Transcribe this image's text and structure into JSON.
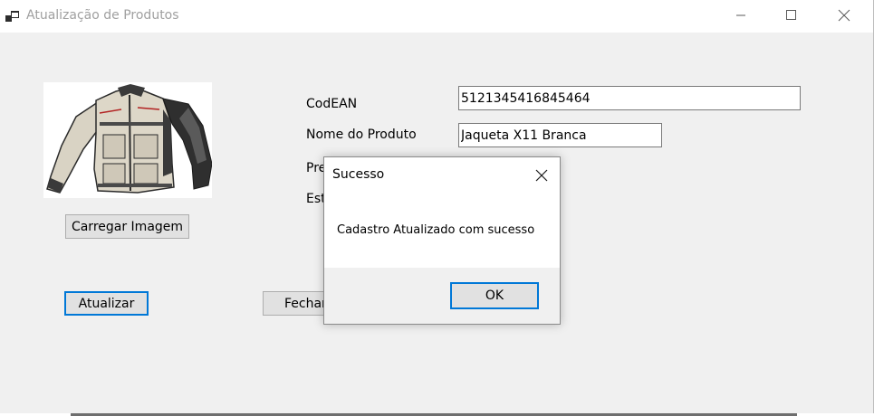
{
  "window": {
    "title": "Atualização de Produtos",
    "app_icon": "app-window-icon",
    "controls": [
      "minimize-icon",
      "maximize-icon",
      "close-icon"
    ]
  },
  "form": {
    "product_image_icon": "jacket-product-image",
    "load_image_button": "Carregar Imagem",
    "update_button": "Atualizar",
    "close_button": "Fechar",
    "labels": {
      "codean": "CodEAN",
      "nome": "Nome do Produto",
      "preco": "Pre",
      "estoque": "Est"
    },
    "fields": {
      "codean_value": "5121345416845464",
      "nome_value": "Jaqueta X11 Branca"
    }
  },
  "dialog": {
    "title": "Sucesso",
    "message": "Cadastro Atualizado com sucesso",
    "ok_label": "OK"
  },
  "colors": {
    "accent": "#0078d7",
    "window_bg": "#f0f0f0",
    "button_bg": "#e1e1e1"
  }
}
